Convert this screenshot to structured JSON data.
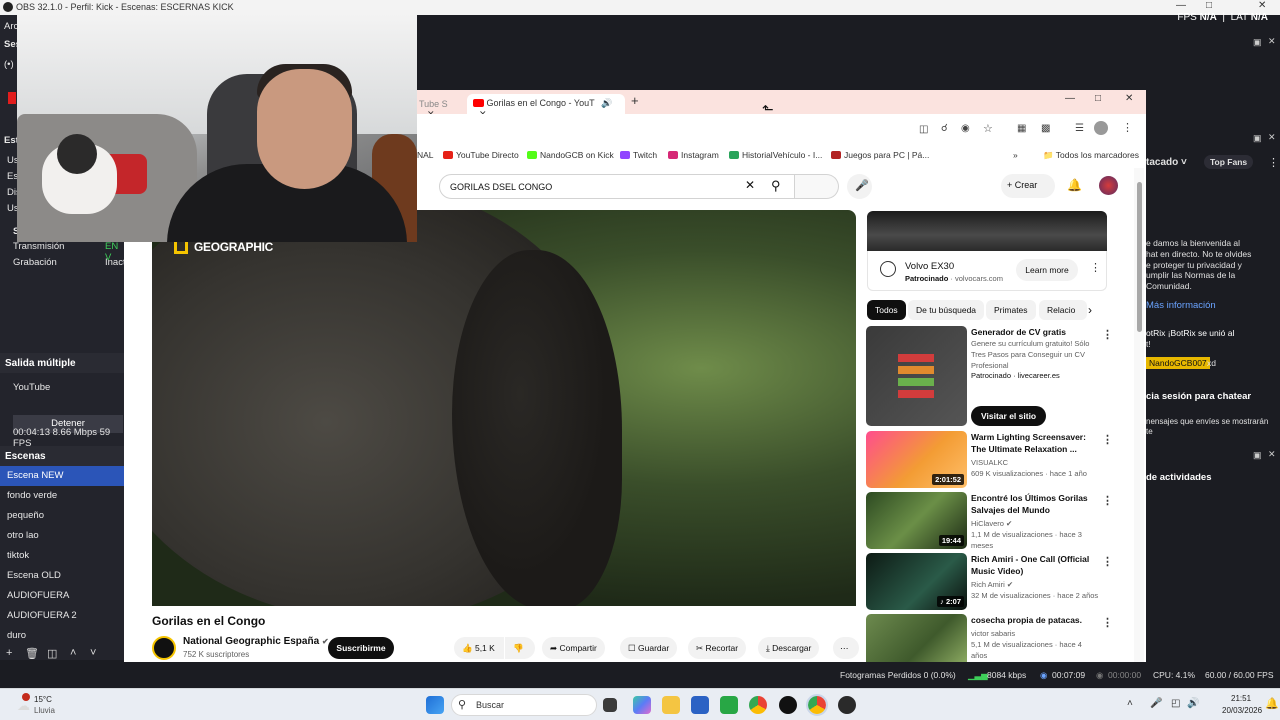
{
  "obs": {
    "title": "OBS 32.1.0 - Perfil: Kick - Escenas: ESCERNAS KICK",
    "fps_label": "FPS",
    "fps_value": "N/A",
    "lat_label": "LAT",
    "lat_value": "N/A",
    "left_fragments": [
      "Arc",
      "Ses",
      "(•)",
      "Est",
      "Us",
      "Esp",
      "Dis",
      "Us",
      "S"
    ],
    "stream_rows": [
      {
        "label": "Transmisión",
        "value": "EN V"
      },
      {
        "label": "Grabación",
        "value": "Inact"
      }
    ],
    "multi_output": {
      "header": "Salida múltiple",
      "platform": "YouTube",
      "stop_label": "Detener",
      "stats": "00:04:13  8.66 Mbps  59 FPS"
    },
    "scenes": {
      "header": "Escenas",
      "items": [
        "Escena NEW",
        "fondo verde",
        "pequeño",
        "otro lao",
        "tiktok",
        "Escena OLD",
        "AUDIOFUERA",
        "AUDIOFUERA 2",
        "duro"
      ],
      "active_index": 0
    },
    "chat": {
      "dropdown_label": "tacado",
      "top_fans": "Top Fans",
      "welcome": "e damos la bienvenida al\nhat en directo. No te olvides\ne proteger tu privacidad y\numplir las Normas de la\nComunidad.",
      "more_info": "Más información",
      "bot_line": "otRix   ¡BotRix se unió al",
      "bot_line2": "t!",
      "user_badge": "NandoGCB007",
      "user_msg": "xd",
      "login": "cia sesión para chatear",
      "login_sub": "nensajes que envíes se mostrarán\nte",
      "activities": "de actividades"
    },
    "status_bar": {
      "dropped": "Fotogramas Perdidos 0 (0.0%)",
      "bitrate": "8084 kbps",
      "stream_time": "00:07:09",
      "rec_time": "00:00:00",
      "cpu": "CPU: 4.1%",
      "fps": "60.00 / 60.00 FPS"
    }
  },
  "chrome": {
    "tabs": [
      {
        "label": "Tube S"
      },
      {
        "label": "Gorilas en el Congo - YouT"
      }
    ],
    "bookmarks": [
      {
        "label": "NAL",
        "color": "#ffffff"
      },
      {
        "label": "YouTube Directo",
        "color": "#e62117"
      },
      {
        "label": "NandoGCB on Kick",
        "color": "#53fc18"
      },
      {
        "label": "Twitch",
        "color": "#9146ff"
      },
      {
        "label": "Instagram",
        "color": "#d62976"
      },
      {
        "label": "HistorialVehículo - I...",
        "color": "#2aa45b"
      },
      {
        "label": "Juegos para PC | Pá...",
        "color": "#b22222"
      }
    ],
    "all_bookmarks": "Todos los marcadores"
  },
  "youtube": {
    "search_value": "GORILAS DSEL CONGO",
    "create_label": "Crear",
    "video_logo": "GEOGRAPHIC",
    "video_title": "Gorilas en el Congo",
    "channel_name": "National Geographic España",
    "channel_subs": "752 K suscriptores",
    "subscribe_label": "Suscribirme",
    "likes": "5,1 K",
    "share_label": "Compartir",
    "save_label": "Guardar",
    "clip_label": "Recortar",
    "download_label": "Descargar",
    "ad": {
      "title": "Volvo EX30",
      "sponsored": "Patrocinado",
      "domain": "volvocars.com",
      "cta": "Learn more"
    },
    "chips": [
      "Todos",
      "De tu búsqueda",
      "Primates",
      "Relacio"
    ],
    "recommendations": [
      {
        "title": "Generador de CV gratis",
        "meta1": "Genere su currículum gratuito! Sólo Tres Pasos para Conseguir un CV Profesional",
        "meta2": "Patrocinado · livecareer.es",
        "cta": "Visitar el sitio",
        "duration": ""
      },
      {
        "title": "Warm Lighting Screensaver: The Ultimate Relaxation ...",
        "meta1": "VISUALKC",
        "meta2": "609 K visualizaciones · hace 1 año",
        "duration": "2:01:52"
      },
      {
        "title": "Encontré los Últimos Gorilas Salvajes del Mundo",
        "meta1": "HiClavero",
        "meta2": "1,1 M de visualizaciones · hace 3 meses",
        "duration": "19:44"
      },
      {
        "title": "Rich Amiri - One Call (Official Music Video)",
        "meta1": "Rich Amiri",
        "meta2": "32 M de visualizaciones · hace 2 años",
        "duration": "♪ 2:07"
      },
      {
        "title": "cosecha propia de patacas.",
        "meta1": "victor sabaris",
        "meta2": "5,1 M de visualizaciones · hace 4 años",
        "duration": ""
      }
    ]
  },
  "taskbar": {
    "weather_temp": "15°C",
    "weather_desc": "Lluvia",
    "search_placeholder": "Buscar",
    "time": "21:51",
    "date": "20/03/2026"
  }
}
